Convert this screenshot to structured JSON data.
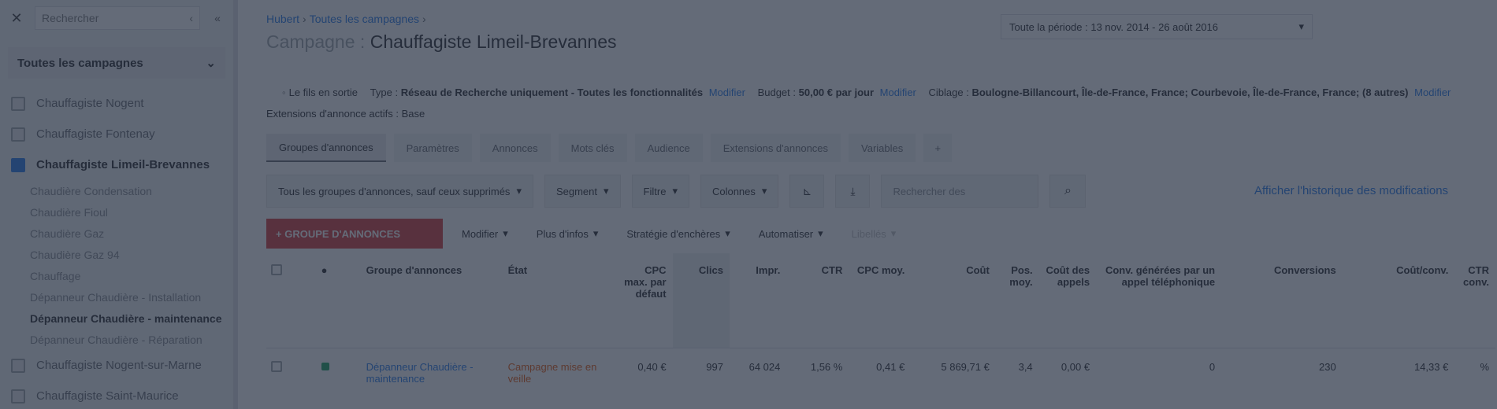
{
  "sidebar": {
    "search_placeholder": "Rechercher",
    "all_campaigns": "Toutes les campagnes",
    "items": [
      {
        "label": "Chauffagiste Nogent",
        "active": false
      },
      {
        "label": "Chauffagiste Fontenay",
        "active": false
      },
      {
        "label": "Chauffagiste Limeil-Brevannes",
        "active": true
      }
    ],
    "subitems": [
      {
        "label": "Chaudière Condensation",
        "active": false
      },
      {
        "label": "Chaudière Fioul",
        "active": false
      },
      {
        "label": "Chaudière Gaz",
        "active": false
      },
      {
        "label": "Chaudière Gaz 94",
        "active": false
      },
      {
        "label": "Chauffage",
        "active": false
      },
      {
        "label": "Dépanneur Chaudière - Installation",
        "active": false
      },
      {
        "label": "Dépanneur Chaudière - maintenance",
        "active": true
      },
      {
        "label": "Dépanneur Chaudière - Réparation",
        "active": false
      }
    ],
    "items_after": [
      {
        "label": "Chauffagiste Nogent-sur-Marne"
      },
      {
        "label": "Chauffagiste Saint-Maurice"
      }
    ]
  },
  "header": {
    "breadcrumb": [
      "Hubert",
      "Toutes les campagnes"
    ],
    "title_prefix": "Campagne :",
    "title": "Chauffagiste Limeil-Brevannes",
    "period": "Toute la période : 13 nov. 2014 - 26 août 2016"
  },
  "info": {
    "status": "Le fils en sortie",
    "type_label": "Type :",
    "type_value": "Réseau de Recherche uniquement - Toutes les fonctionnalités",
    "edit1": "Modifier",
    "budget_label": "Budget :",
    "budget_value": "50,00 € par jour",
    "edit2": "Modifier",
    "target_label": "Ciblage :",
    "target_value": "Boulogne-Billancourt, Île-de-France, France; Courbevoie, Île-de-France, France; (8 autres)",
    "edit3": "Modifier",
    "extensions": "Extensions d'annonce actifs : Base"
  },
  "tabs": [
    "Groupes d'annonces",
    "Paramètres",
    "Annonces",
    "Mots clés",
    "Audience",
    "Extensions d'annonces",
    "Variables",
    "+"
  ],
  "toolbar": {
    "filter_select": "Tous les groupes d'annonces, sauf ceux supprimés",
    "segment": "Segment",
    "filter": "Filtre",
    "columns": "Colonnes",
    "search_placeholder": "Rechercher des",
    "history_link": "Afficher l'historique des modifications"
  },
  "actions": {
    "new_group": "+ GROUPE D'ANNONCES",
    "modify": "Modifier",
    "more": "Plus d'infos",
    "strategy": "Stratégie d'enchères",
    "automate": "Automatiser",
    "labels": "Libellés"
  },
  "table": {
    "headers": [
      "",
      "",
      "Groupe d'annonces",
      "État",
      "CPC max. par défaut",
      "Clics",
      "Impr.",
      "CTR",
      "CPC moy.",
      "Coût",
      "Pos. moy.",
      "Coût des appels",
      "Conv. générées par un appel téléphonique",
      "Conversions",
      "Coût/conv.",
      "CTR conv."
    ],
    "rows": [
      [
        "",
        "",
        "Dépanneur Chaudière - maintenance",
        "Campagne mise en veille",
        "0,40 €",
        "997",
        "64 024",
        "1,56 %",
        "0,41 €",
        "5 869,71 €",
        "3,4",
        "0,00 €",
        "0",
        "230",
        "14,33 €",
        "%"
      ]
    ]
  }
}
